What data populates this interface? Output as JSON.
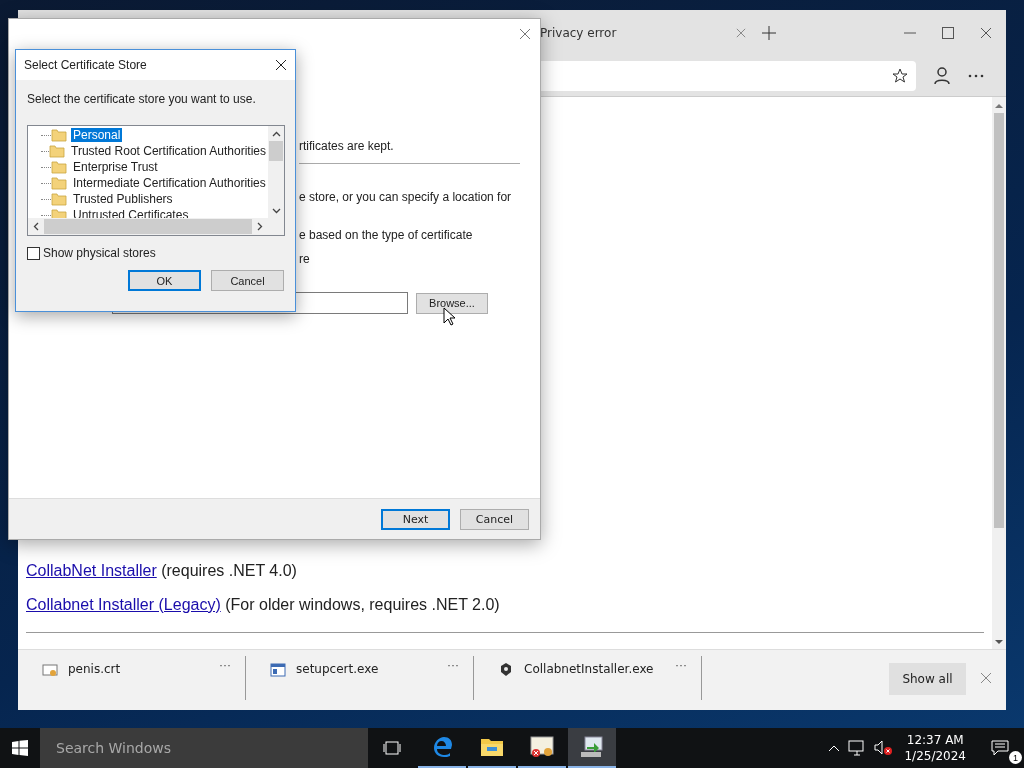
{
  "browser": {
    "tab": {
      "title": "Privacy error"
    },
    "page": {
      "links": [
        {
          "link": "CollabNet Installer",
          "note": "(requires .NET 4.0)"
        },
        {
          "link": "Collabnet Installer (Legacy)",
          "note": "(For older windows, requires .NET 2.0)"
        }
      ]
    },
    "downloads": {
      "items": [
        {
          "kind": "certificate",
          "name": "penis.crt",
          "more": "···"
        },
        {
          "kind": "executable",
          "name": "setupcert.exe",
          "more": "···"
        },
        {
          "kind": "installer",
          "name": "CollabnetInstaller.exe",
          "more": "···"
        }
      ],
      "show_all": "Show all"
    }
  },
  "wizard": {
    "fragments": [
      "rtificates are kept.",
      "e store, or you can specify a location for",
      "e based on the type of certificate",
      "re"
    ],
    "browse": "Browse...",
    "buttons": [
      {
        "label": "Next",
        "default": true
      },
      {
        "label": "Cancel",
        "default": false
      }
    ]
  },
  "dialog": {
    "title": "Select Certificate Store",
    "prompt": "Select the certificate store you want to use.",
    "stores": [
      {
        "label": "Personal",
        "selected": true
      },
      {
        "label": "Trusted Root Certification Authorities",
        "selected": false
      },
      {
        "label": "Enterprise Trust",
        "selected": false
      },
      {
        "label": "Intermediate Certification Authorities",
        "selected": false
      },
      {
        "label": "Trusted Publishers",
        "selected": false
      },
      {
        "label": "Untrusted Certificates",
        "selected": false
      }
    ],
    "show_physical_stores": {
      "label": "Show physical stores",
      "checked": false
    },
    "buttons": [
      {
        "label": "OK",
        "default": true
      },
      {
        "label": "Cancel",
        "default": false
      }
    ]
  },
  "taskbar": {
    "search_placeholder": "Search Windows",
    "apps": [
      {
        "kind": "browser",
        "selected": false
      },
      {
        "kind": "folder",
        "selected": false
      },
      {
        "kind": "certificate",
        "selected": false
      },
      {
        "kind": "installer",
        "selected": true
      }
    ],
    "time": "12:37 AM",
    "date": "1/25/2024",
    "notification_count": "1"
  }
}
